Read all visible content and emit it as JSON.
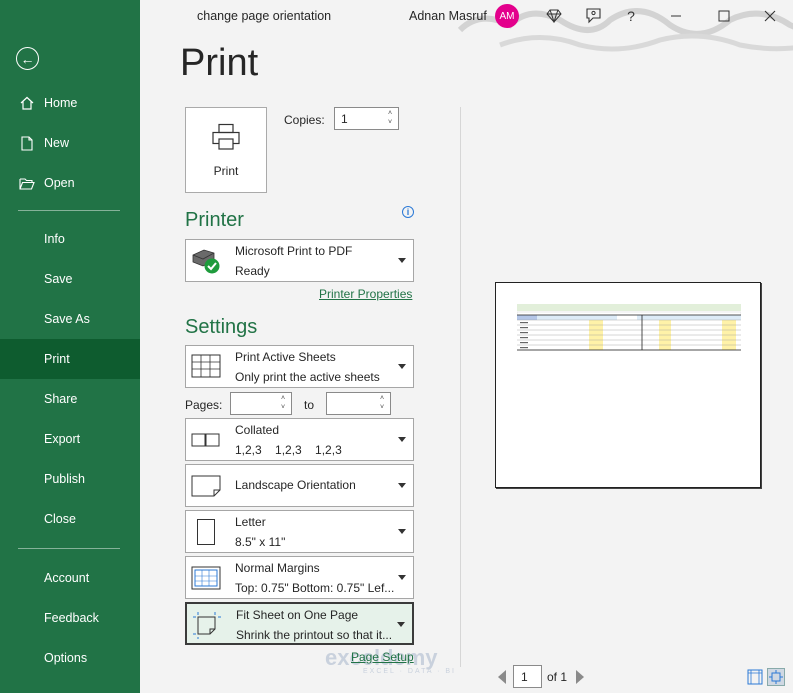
{
  "window": {
    "doc_title": "change page orientation",
    "user_name": "Adnan Masruf",
    "avatar_initials": "AM"
  },
  "sidebar": {
    "items": [
      {
        "label": "Home",
        "icon": "home-icon"
      },
      {
        "label": "New",
        "icon": "new-doc-icon"
      },
      {
        "label": "Open",
        "icon": "folder-open-icon"
      },
      {
        "label": "Info"
      },
      {
        "label": "Save"
      },
      {
        "label": "Save As"
      },
      {
        "label": "Print",
        "active": true
      },
      {
        "label": "Share"
      },
      {
        "label": "Export"
      },
      {
        "label": "Publish"
      },
      {
        "label": "Close"
      },
      {
        "label": "Account"
      },
      {
        "label": "Feedback"
      },
      {
        "label": "Options"
      }
    ]
  },
  "print": {
    "title": "Print",
    "print_button": "Print",
    "copies_label": "Copies:",
    "copies_value": "1",
    "printer_heading": "Printer",
    "printer_name": "Microsoft Print to PDF",
    "printer_status": "Ready",
    "printer_properties": "Printer Properties",
    "settings_heading": "Settings",
    "sheets_line1": "Print Active Sheets",
    "sheets_line2": "Only print the active sheets",
    "pages_label": "Pages:",
    "pages_to": "to",
    "collated_line1": "Collated",
    "collated_line2": "1,2,3    1,2,3    1,2,3",
    "orientation": "Landscape Orientation",
    "paper_line1": "Letter",
    "paper_line2": "8.5\" x 11\"",
    "margins_line1": "Normal Margins",
    "margins_line2": "Top: 0.75\" Bottom: 0.75\" Lef...",
    "scaling_line1": "Fit Sheet on One Page",
    "scaling_line2": "Shrink the printout so that it...",
    "page_setup": "Page Setup"
  },
  "preview": {
    "current_page": "1",
    "of_pages": "of 1"
  },
  "watermark": {
    "brand": "exceldemy",
    "tagline": "EXCEL · DATA · BI"
  },
  "colors": {
    "sidebar": "#217346",
    "sidebar_active": "#0e5c2f",
    "accent": "#217346",
    "avatar": "#e3008c"
  }
}
